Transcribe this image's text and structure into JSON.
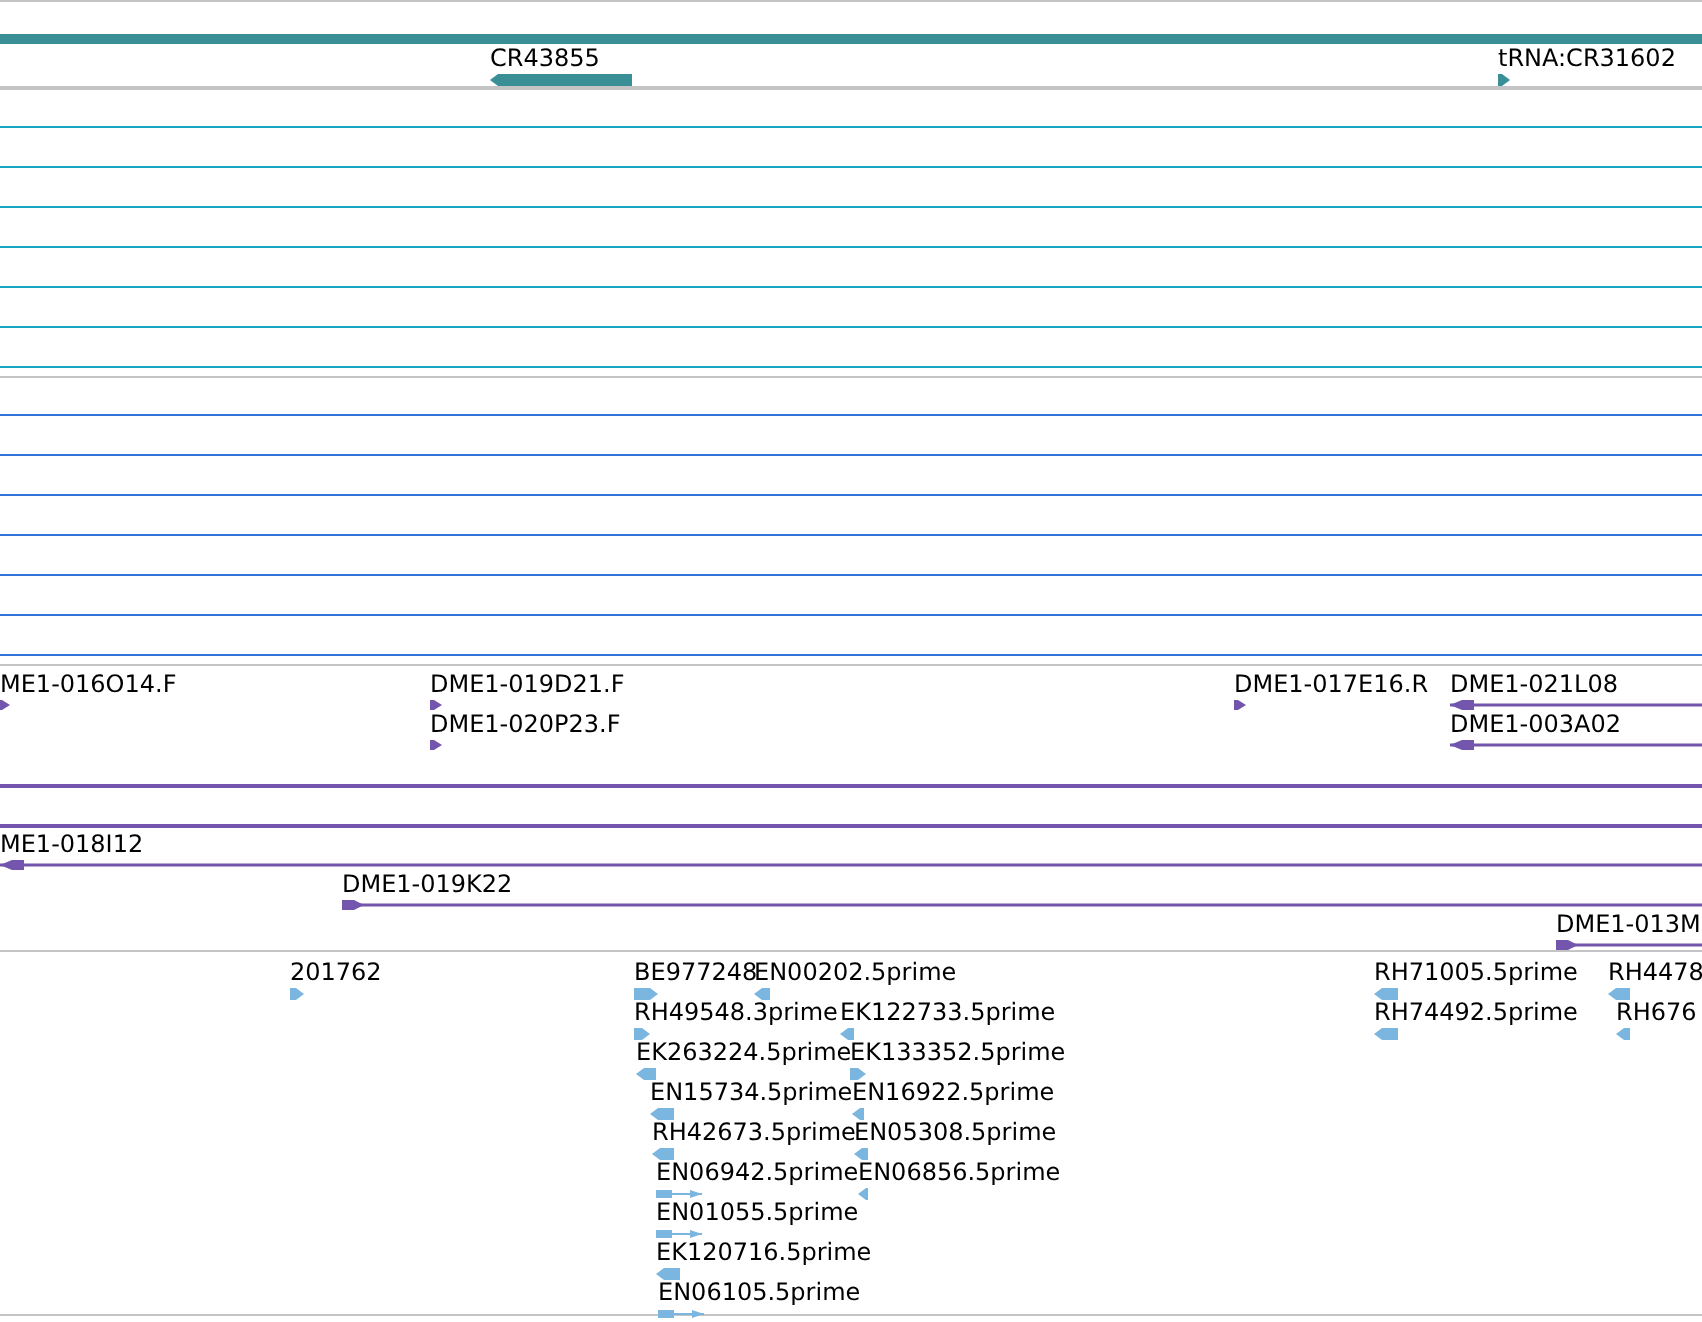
{
  "gene_track": {
    "features": [
      {
        "label": "CR43855",
        "reverse": true,
        "kind": "marker"
      },
      {
        "label": "tRNA:CR31602",
        "reverse": false,
        "kind": "marker"
      }
    ]
  },
  "clone_track": {
    "features": [
      {
        "label": "ME1-016O14.F",
        "reverse": false,
        "kind": "marker"
      },
      {
        "label": "DME1-019D21.F",
        "reverse": false,
        "kind": "marker"
      },
      {
        "label": "DME1-020P23.F",
        "reverse": false,
        "kind": "marker"
      },
      {
        "label": "DME1-017E16.R",
        "reverse": false,
        "kind": "marker"
      },
      {
        "label": "DME1-021L08",
        "reverse": true,
        "kind": "span"
      },
      {
        "label": "DME1-003A02",
        "reverse": true,
        "kind": "span"
      },
      {
        "label": "ME1-018I12",
        "reverse": true,
        "kind": "span"
      },
      {
        "label": "DME1-019K22",
        "reverse": false,
        "kind": "span"
      },
      {
        "label": "DME1-013M",
        "reverse": false,
        "kind": "span"
      }
    ]
  },
  "est_track": {
    "features": [
      {
        "label": "201762",
        "reverse": false,
        "kind": "marker"
      },
      {
        "label": "BE977248",
        "reverse": false,
        "kind": "marker"
      },
      {
        "label": "EN00202.5prime",
        "reverse": true,
        "kind": "marker"
      },
      {
        "label": "RH49548.3prime",
        "reverse": false,
        "kind": "marker"
      },
      {
        "label": "EK122733.5prime",
        "reverse": true,
        "kind": "marker"
      },
      {
        "label": "EK263224.5prime",
        "reverse": true,
        "kind": "marker"
      },
      {
        "label": "EK133352.5prime",
        "reverse": false,
        "kind": "marker"
      },
      {
        "label": "EN15734.5prime",
        "reverse": true,
        "kind": "marker"
      },
      {
        "label": "EN16922.5prime",
        "reverse": true,
        "kind": "marker"
      },
      {
        "label": "RH42673.5prime",
        "reverse": true,
        "kind": "marker"
      },
      {
        "label": "EN05308.5prime",
        "reverse": true,
        "kind": "marker"
      },
      {
        "label": "EN06942.5prime",
        "reverse": false,
        "kind": "spliced"
      },
      {
        "label": "EN06856.5prime",
        "reverse": true,
        "kind": "marker"
      },
      {
        "label": "EN01055.5prime",
        "reverse": false,
        "kind": "spliced"
      },
      {
        "label": "EK120716.5prime",
        "reverse": true,
        "kind": "marker"
      },
      {
        "label": "EN06105.5prime",
        "reverse": false,
        "kind": "spliced"
      },
      {
        "label": "RH71005.5prime",
        "reverse": true,
        "kind": "marker"
      },
      {
        "label": "RH74492.5prime",
        "reverse": true,
        "kind": "marker"
      },
      {
        "label": "RH4478",
        "reverse": true,
        "kind": "marker"
      },
      {
        "label": "RH676",
        "reverse": true,
        "kind": "marker"
      }
    ]
  }
}
